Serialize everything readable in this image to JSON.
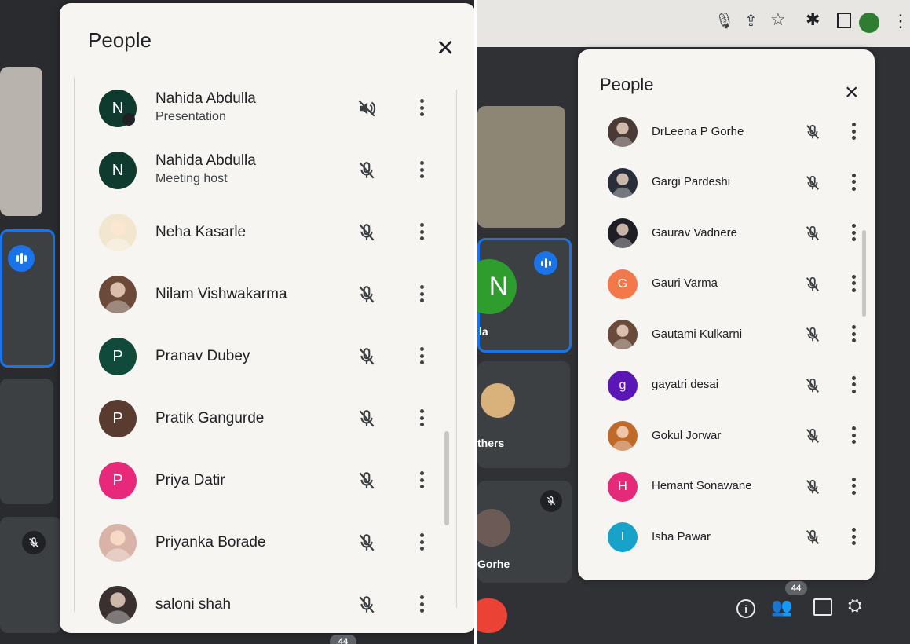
{
  "left": {
    "title": "People",
    "close": "×",
    "participants": [
      {
        "name": "Nahida Abdulla",
        "sub": "Presentation",
        "avatar_letter": "N",
        "avatar_color": "#0f3b2f",
        "presenting": true
      },
      {
        "name": "Nahida Abdulla",
        "sub": "Meeting host",
        "avatar_letter": "N",
        "avatar_color": "#0f3b2f"
      },
      {
        "name": "Neha Kasarle",
        "sub": "",
        "avatar_letter": "",
        "avatar_color": "#f2e6d0",
        "photo": true
      },
      {
        "name": "Nilam Vishwakarma",
        "sub": "",
        "avatar_letter": "",
        "avatar_color": "#6b4a3a",
        "photo": true
      },
      {
        "name": "Pranav Dubey",
        "sub": "",
        "avatar_letter": "P",
        "avatar_color": "#0f4a3a"
      },
      {
        "name": "Pratik Gangurde",
        "sub": "",
        "avatar_letter": "P",
        "avatar_color": "#5a3b30"
      },
      {
        "name": "Priya Datir",
        "sub": "",
        "avatar_letter": "P",
        "avatar_color": "#e8287a"
      },
      {
        "name": "Priyanka Borade",
        "sub": "",
        "avatar_letter": "",
        "avatar_color": "#d9b3a8",
        "photo": true
      },
      {
        "name": "saloni shah",
        "sub": "",
        "avatar_letter": "",
        "avatar_color": "#3a3030",
        "photo": true
      }
    ],
    "bottom_badge": "44"
  },
  "right": {
    "title": "People",
    "close": "×",
    "participants": [
      {
        "name": "DrLeena P Gorhe",
        "avatar_letter": "",
        "avatar_color": "#4a3a35",
        "photo": true
      },
      {
        "name": "Gargi Pardeshi",
        "avatar_letter": "",
        "avatar_color": "#2a2e3a",
        "photo": true
      },
      {
        "name": "Gaurav Vadnere",
        "avatar_letter": "",
        "avatar_color": "#1e1e24",
        "photo": true
      },
      {
        "name": "Gauri Varma",
        "avatar_letter": "G",
        "avatar_color": "#f4794a"
      },
      {
        "name": "Gautami Kulkarni",
        "avatar_letter": "",
        "avatar_color": "#6a4a3a",
        "photo": true
      },
      {
        "name": "gayatri desai",
        "avatar_letter": "g",
        "avatar_color": "#5b16b6"
      },
      {
        "name": "Gokul Jorwar",
        "avatar_letter": "",
        "avatar_color": "#c06a2a",
        "photo": true
      },
      {
        "name": "Hemant Sonawane",
        "avatar_letter": "H",
        "avatar_color": "#e52a7a"
      },
      {
        "name": "Isha Pawar",
        "avatar_letter": "I",
        "avatar_color": "#16a2c9"
      }
    ],
    "tile_labels": {
      "la": "la",
      "others": "thers",
      "gorhe": "Gorhe"
    },
    "people_badge": "44",
    "tile_letter": "N"
  }
}
